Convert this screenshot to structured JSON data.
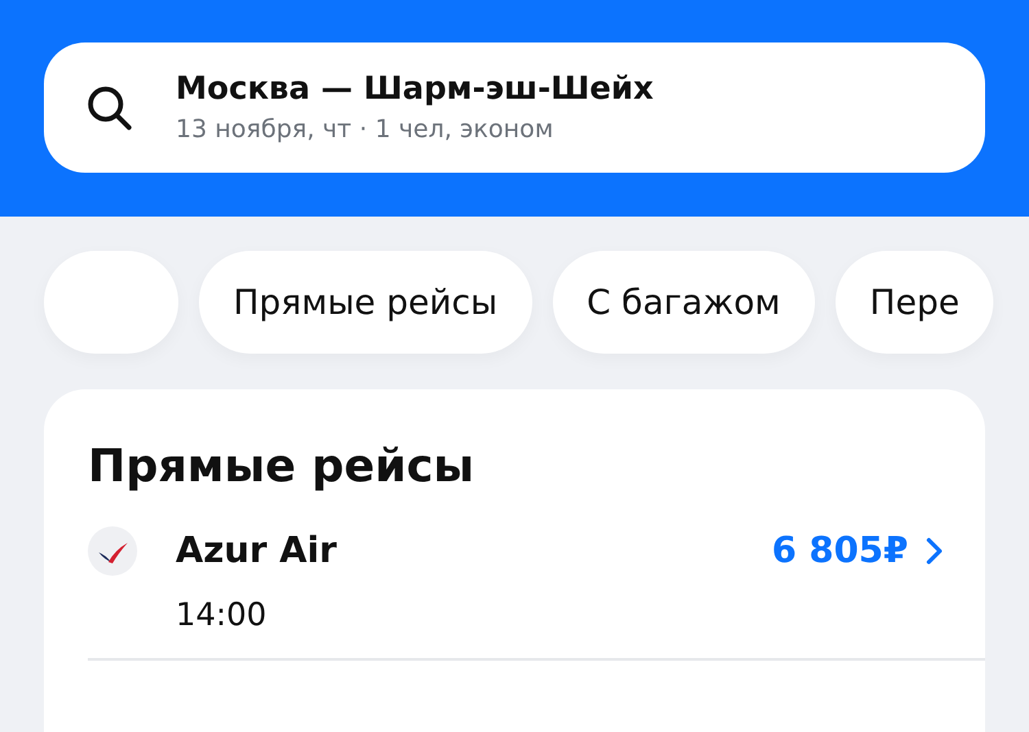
{
  "search": {
    "route": "Москва — Шарм-эш-Шейх",
    "details": "13 ноября, чт · 1 чел, эконом"
  },
  "filters": [
    {
      "kind": "icon"
    },
    {
      "kind": "text",
      "label": "Прямые рейсы"
    },
    {
      "kind": "text",
      "label": "С багажом"
    },
    {
      "kind": "text",
      "label": "Пере"
    }
  ],
  "section": {
    "title": "Прямые рейсы",
    "flights": [
      {
        "airline": "Azur Air",
        "price": "6 805₽",
        "time": "14:00"
      }
    ]
  }
}
